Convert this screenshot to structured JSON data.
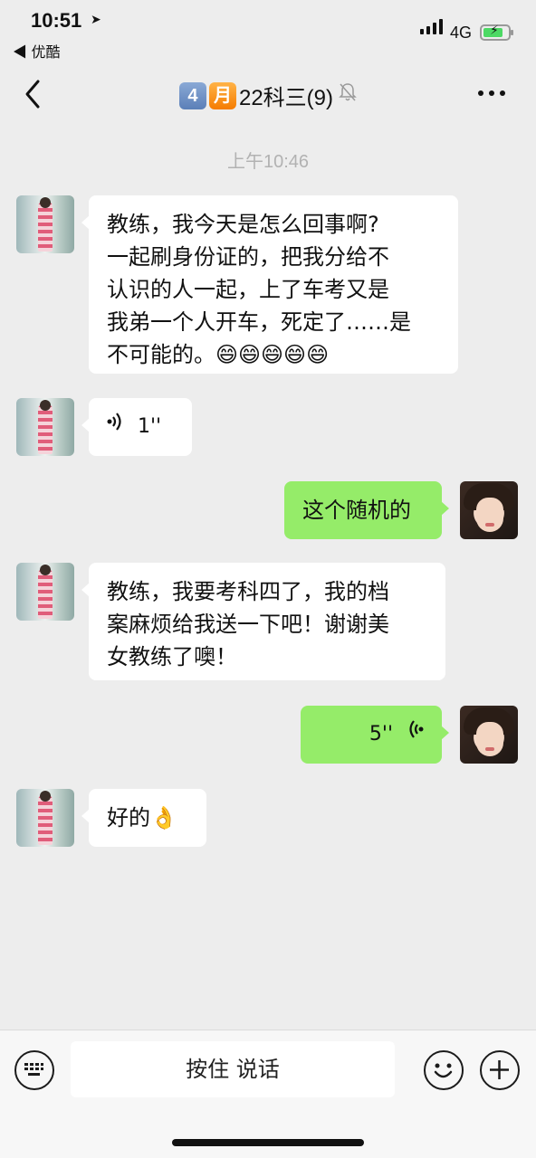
{
  "status_bar": {
    "time": "10:51",
    "back_app": "◀ 优酷",
    "network": "4G",
    "battery_level": 0.7
  },
  "nav": {
    "title_emoji_1": "4",
    "title_emoji_2": "月",
    "title_text": "22科三(9)"
  },
  "chat": {
    "timestamp": "上午10:46",
    "messages": [
      {
        "side": "left",
        "type": "text",
        "text": "教练，我今天是怎么回事啊?\n一起刷身份证的，把我分给不\n认识的人一起，上了车考又是\n我弟一个人开车，死定了……是\n不可能的。😄😄😄😄😄"
      },
      {
        "side": "left",
        "type": "voice",
        "duration": "1''"
      },
      {
        "side": "right",
        "type": "text",
        "text": "这个随机的"
      },
      {
        "side": "left",
        "type": "text",
        "text": "教练，我要考科四了，我的档\n案麻烦给我送一下吧！谢谢美\n女教练了噢！"
      },
      {
        "side": "right",
        "type": "voice",
        "duration": "5''"
      },
      {
        "side": "left",
        "type": "text",
        "text": "好的👌"
      }
    ]
  },
  "input_bar": {
    "hold_to_talk": "按住 说话"
  },
  "icons": {
    "back": "chevron-left-icon",
    "mute": "bell-slash-icon",
    "more": "more-dots-icon",
    "keyboard": "keyboard-icon",
    "emoji": "emoji-icon",
    "plus": "plus-icon",
    "voice": "voice-wave-icon"
  },
  "colors": {
    "background": "#ededed",
    "bubble_left": "#ffffff",
    "bubble_right": "#95ec69"
  }
}
